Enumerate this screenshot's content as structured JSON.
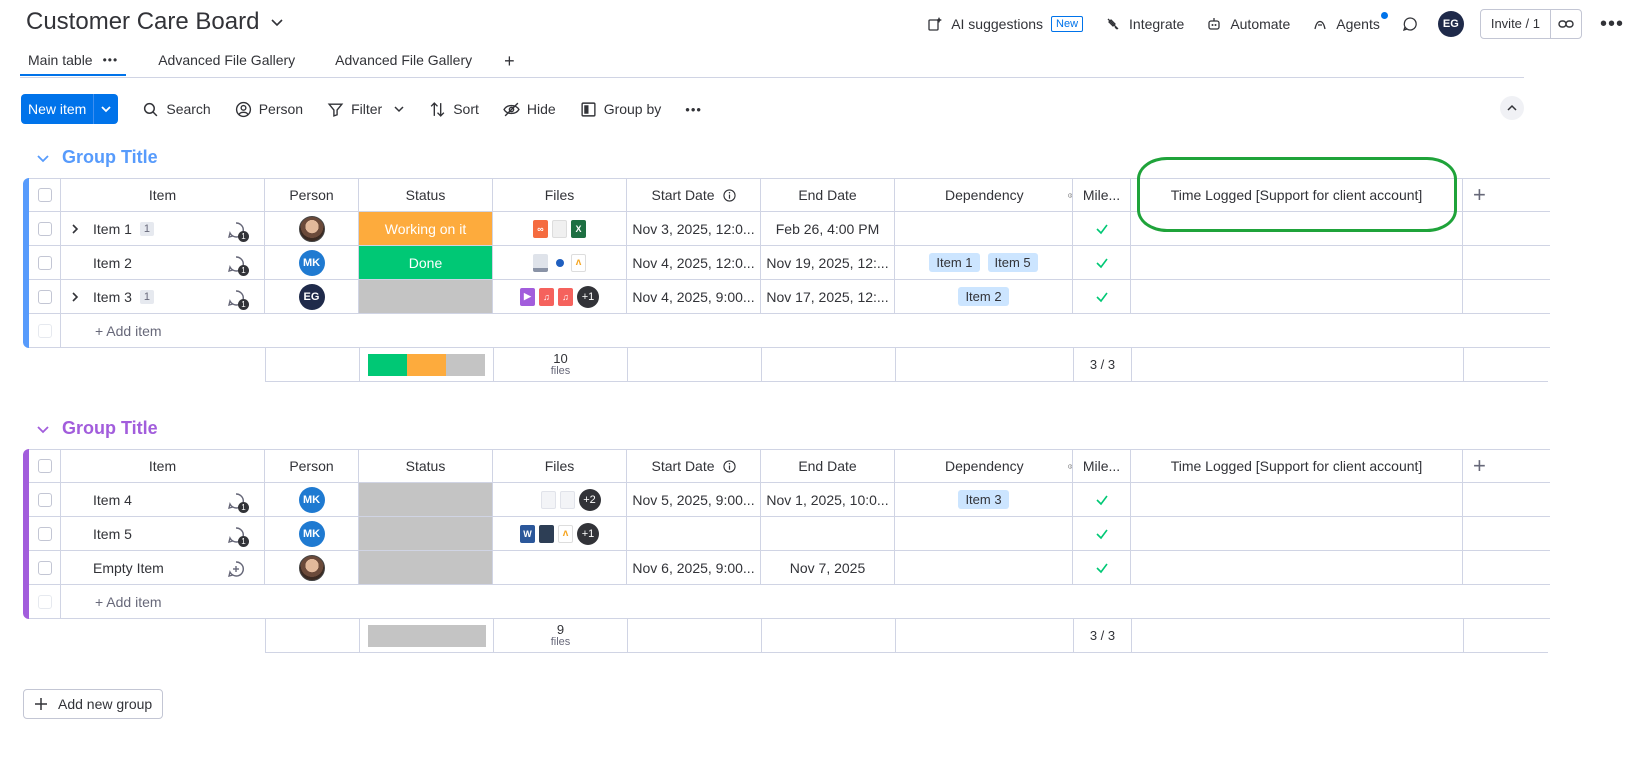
{
  "board": {
    "title": "Customer Care Board"
  },
  "topbar": {
    "ai_label": "AI suggestions",
    "ai_badge": "New",
    "integrate": "Integrate",
    "automate": "Automate",
    "agents": "Agents",
    "user_initials": "EG",
    "invite": "Invite / 1"
  },
  "tabs": [
    {
      "label": "Main table"
    },
    {
      "label": "Advanced File Gallery"
    },
    {
      "label": "Advanced File Gallery"
    }
  ],
  "toolbar": {
    "new_item": "New item",
    "search": "Search",
    "person": "Person",
    "filter": "Filter",
    "sort": "Sort",
    "hide": "Hide",
    "group_by": "Group by"
  },
  "columns": {
    "item": "Item",
    "person": "Person",
    "status": "Status",
    "files": "Files",
    "start": "Start Date",
    "end": "End Date",
    "dependency": "Dependency",
    "milestone": "Mile...",
    "time": "Time Logged [Support for client account]"
  },
  "colors": {
    "group1": "#579bfc",
    "group2": "#a25ddc",
    "working": "#fdab3d",
    "done": "#00c875",
    "empty": "#c4c4c4",
    "highlight": "#1fa33a"
  },
  "groups": [
    {
      "title": "Group Title",
      "rows": [
        {
          "name": "Item 1",
          "subitems": "1",
          "person": "photo",
          "status": "Working on it",
          "files_more": "",
          "start": "Nov 3, 2025, 12:0...",
          "end": "Feb 26, 4:00 PM",
          "deps": []
        },
        {
          "name": "Item 2",
          "subitems": "",
          "person": "MK",
          "status": "Done",
          "files_more": "",
          "start": "Nov 4, 2025, 12:0...",
          "end": "Nov 19, 2025, 12:...",
          "deps": [
            "Item 1",
            "Item 5"
          ]
        },
        {
          "name": "Item 3",
          "subitems": "1",
          "person": "EG",
          "status": "",
          "files_more": "+1",
          "start": "Nov 4, 2025, 9:00...",
          "end": "Nov 17, 2025, 12:...",
          "deps": [
            "Item 2"
          ]
        }
      ],
      "add_item": "+ Add item",
      "summary": {
        "files_count": "10",
        "files_unit": "files",
        "milestone": "3 / 3"
      }
    },
    {
      "title": "Group Title",
      "rows": [
        {
          "name": "Item 4",
          "subitems": "",
          "person": "MK",
          "status": "",
          "files_more": "+2",
          "start": "Nov 5, 2025, 9:00...",
          "end": "Nov 1, 2025, 10:0...",
          "deps": [
            "Item 3"
          ]
        },
        {
          "name": "Item 5",
          "subitems": "",
          "person": "MK",
          "status": "",
          "files_more": "+1",
          "start": "",
          "end": "",
          "deps": []
        },
        {
          "name": "Empty Item",
          "subitems": "",
          "person": "photo",
          "status": "",
          "files_more": "",
          "start": "Nov 6, 2025, 9:00...",
          "end": "Nov 7, 2025",
          "deps": []
        }
      ],
      "add_item": "+ Add item",
      "summary": {
        "files_count": "9",
        "files_unit": "files",
        "milestone": "3 / 3"
      }
    }
  ],
  "add_group": "Add new group"
}
